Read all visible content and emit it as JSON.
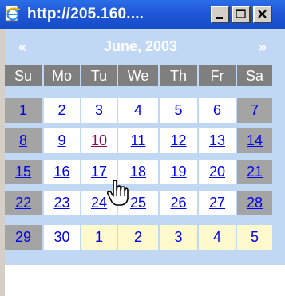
{
  "window": {
    "title": "http://205.160....",
    "controls": {
      "minimize": "minimize",
      "maximize": "maximize",
      "close": "close"
    }
  },
  "calendar": {
    "prev_label": "«",
    "next_label": "»",
    "month_title": "June, 2003",
    "day_headers": [
      "Su",
      "Mo",
      "Tu",
      "We",
      "Th",
      "Fr",
      "Sa"
    ],
    "weeks": [
      [
        "1",
        "2",
        "3",
        "4",
        "5",
        "6",
        "7"
      ],
      [
        "8",
        "9",
        "10",
        "11",
        "12",
        "13",
        "14"
      ],
      [
        "15",
        "16",
        "17",
        "18",
        "19",
        "20",
        "21"
      ],
      [
        "22",
        "23",
        "24",
        "25",
        "26",
        "27",
        "28"
      ],
      [
        "29",
        "30",
        "1",
        "2",
        "3",
        "4",
        "5"
      ]
    ],
    "hovered_day": "10"
  },
  "colors": {
    "titlebar": "#1f57d8",
    "header_bg": "#c0d8f4",
    "day_header_bg": "#7f7f7f",
    "weekend_bg": "#a4a4a4",
    "weekday_bg": "#ffffff",
    "other_month_bg": "#fffacd",
    "link": "#0000ee",
    "hover_link": "#8b0a50"
  }
}
